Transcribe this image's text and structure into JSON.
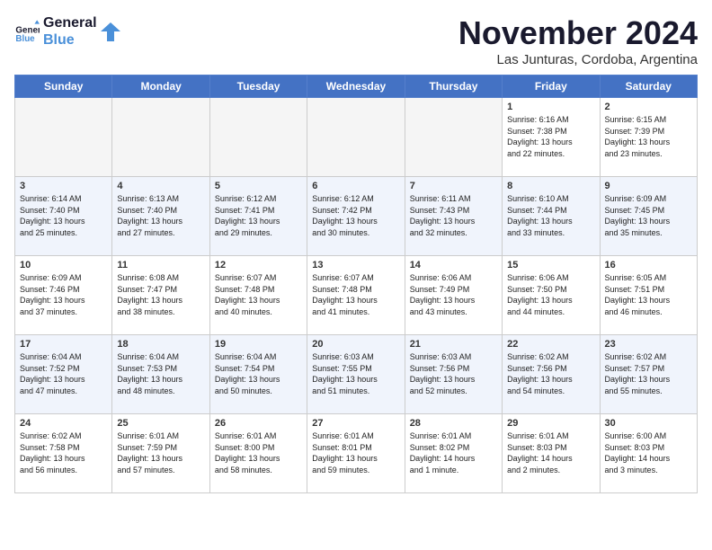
{
  "header": {
    "logo_line1": "General",
    "logo_line2": "Blue",
    "month": "November 2024",
    "location": "Las Junturas, Cordoba, Argentina"
  },
  "weekdays": [
    "Sunday",
    "Monday",
    "Tuesday",
    "Wednesday",
    "Thursday",
    "Friday",
    "Saturday"
  ],
  "weeks": [
    [
      {
        "day": "",
        "info": ""
      },
      {
        "day": "",
        "info": ""
      },
      {
        "day": "",
        "info": ""
      },
      {
        "day": "",
        "info": ""
      },
      {
        "day": "",
        "info": ""
      },
      {
        "day": "1",
        "info": "Sunrise: 6:16 AM\nSunset: 7:38 PM\nDaylight: 13 hours\nand 22 minutes."
      },
      {
        "day": "2",
        "info": "Sunrise: 6:15 AM\nSunset: 7:39 PM\nDaylight: 13 hours\nand 23 minutes."
      }
    ],
    [
      {
        "day": "3",
        "info": "Sunrise: 6:14 AM\nSunset: 7:40 PM\nDaylight: 13 hours\nand 25 minutes."
      },
      {
        "day": "4",
        "info": "Sunrise: 6:13 AM\nSunset: 7:40 PM\nDaylight: 13 hours\nand 27 minutes."
      },
      {
        "day": "5",
        "info": "Sunrise: 6:12 AM\nSunset: 7:41 PM\nDaylight: 13 hours\nand 29 minutes."
      },
      {
        "day": "6",
        "info": "Sunrise: 6:12 AM\nSunset: 7:42 PM\nDaylight: 13 hours\nand 30 minutes."
      },
      {
        "day": "7",
        "info": "Sunrise: 6:11 AM\nSunset: 7:43 PM\nDaylight: 13 hours\nand 32 minutes."
      },
      {
        "day": "8",
        "info": "Sunrise: 6:10 AM\nSunset: 7:44 PM\nDaylight: 13 hours\nand 33 minutes."
      },
      {
        "day": "9",
        "info": "Sunrise: 6:09 AM\nSunset: 7:45 PM\nDaylight: 13 hours\nand 35 minutes."
      }
    ],
    [
      {
        "day": "10",
        "info": "Sunrise: 6:09 AM\nSunset: 7:46 PM\nDaylight: 13 hours\nand 37 minutes."
      },
      {
        "day": "11",
        "info": "Sunrise: 6:08 AM\nSunset: 7:47 PM\nDaylight: 13 hours\nand 38 minutes."
      },
      {
        "day": "12",
        "info": "Sunrise: 6:07 AM\nSunset: 7:48 PM\nDaylight: 13 hours\nand 40 minutes."
      },
      {
        "day": "13",
        "info": "Sunrise: 6:07 AM\nSunset: 7:48 PM\nDaylight: 13 hours\nand 41 minutes."
      },
      {
        "day": "14",
        "info": "Sunrise: 6:06 AM\nSunset: 7:49 PM\nDaylight: 13 hours\nand 43 minutes."
      },
      {
        "day": "15",
        "info": "Sunrise: 6:06 AM\nSunset: 7:50 PM\nDaylight: 13 hours\nand 44 minutes."
      },
      {
        "day": "16",
        "info": "Sunrise: 6:05 AM\nSunset: 7:51 PM\nDaylight: 13 hours\nand 46 minutes."
      }
    ],
    [
      {
        "day": "17",
        "info": "Sunrise: 6:04 AM\nSunset: 7:52 PM\nDaylight: 13 hours\nand 47 minutes."
      },
      {
        "day": "18",
        "info": "Sunrise: 6:04 AM\nSunset: 7:53 PM\nDaylight: 13 hours\nand 48 minutes."
      },
      {
        "day": "19",
        "info": "Sunrise: 6:04 AM\nSunset: 7:54 PM\nDaylight: 13 hours\nand 50 minutes."
      },
      {
        "day": "20",
        "info": "Sunrise: 6:03 AM\nSunset: 7:55 PM\nDaylight: 13 hours\nand 51 minutes."
      },
      {
        "day": "21",
        "info": "Sunrise: 6:03 AM\nSunset: 7:56 PM\nDaylight: 13 hours\nand 52 minutes."
      },
      {
        "day": "22",
        "info": "Sunrise: 6:02 AM\nSunset: 7:56 PM\nDaylight: 13 hours\nand 54 minutes."
      },
      {
        "day": "23",
        "info": "Sunrise: 6:02 AM\nSunset: 7:57 PM\nDaylight: 13 hours\nand 55 minutes."
      }
    ],
    [
      {
        "day": "24",
        "info": "Sunrise: 6:02 AM\nSunset: 7:58 PM\nDaylight: 13 hours\nand 56 minutes."
      },
      {
        "day": "25",
        "info": "Sunrise: 6:01 AM\nSunset: 7:59 PM\nDaylight: 13 hours\nand 57 minutes."
      },
      {
        "day": "26",
        "info": "Sunrise: 6:01 AM\nSunset: 8:00 PM\nDaylight: 13 hours\nand 58 minutes."
      },
      {
        "day": "27",
        "info": "Sunrise: 6:01 AM\nSunset: 8:01 PM\nDaylight: 13 hours\nand 59 minutes."
      },
      {
        "day": "28",
        "info": "Sunrise: 6:01 AM\nSunset: 8:02 PM\nDaylight: 14 hours\nand 1 minute."
      },
      {
        "day": "29",
        "info": "Sunrise: 6:01 AM\nSunset: 8:03 PM\nDaylight: 14 hours\nand 2 minutes."
      },
      {
        "day": "30",
        "info": "Sunrise: 6:00 AM\nSunset: 8:03 PM\nDaylight: 14 hours\nand 3 minutes."
      }
    ]
  ]
}
